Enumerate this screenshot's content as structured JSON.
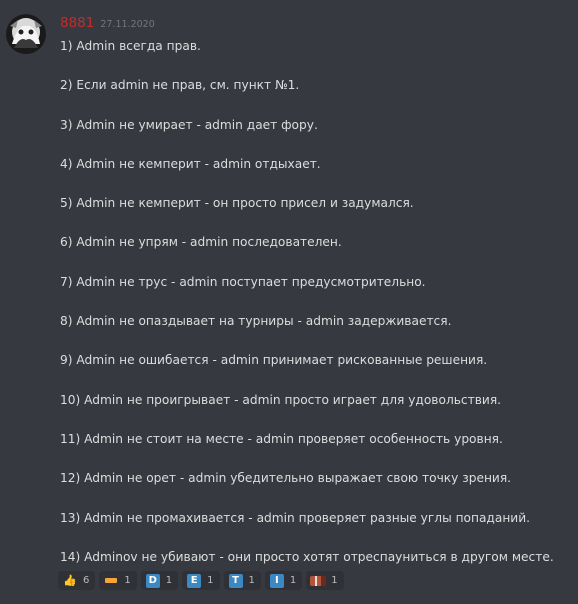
{
  "message": {
    "username": "8881",
    "timestamp": "27.11.2020",
    "lines": [
      "1) Admin всегда прав.",
      "2) Если admin не прав, см. пункт №1.",
      "3) Admin не умирает - admin дает фору.",
      "4) Admin не кемперит - admin отдыхает.",
      "5) Admin не кемперит - он просто присел и задумался.",
      "6) Admin не упрям - admin последователен.",
      "7) Admin не трус - admin поступает предусмотрительно.",
      "8) Admin не опаздывает на турниры - admin задерживается.",
      "9) Admin не ошибается - admin принимает рискованные решения.",
      "10) Admin не проигрывает - admin просто играет для удовольствия.",
      "11) Admin не стоит на месте - admin проверяет особенность уровня.",
      "12) Admin не орет - admin убедительно выражает свою точку зрения.",
      "13) Admin не промахивается - admin проверяет разные углы попаданий.",
      "14) Adminov не убивают - они просто хотят отреспауниться в другом месте."
    ]
  },
  "reactions": [
    {
      "emoji": "thumbs-up-icon",
      "count": "6"
    },
    {
      "emoji": "dash-icon",
      "count": "1"
    },
    {
      "emoji": "regional-d-icon",
      "letter": "D",
      "count": "1"
    },
    {
      "emoji": "regional-e-icon",
      "letter": "E",
      "count": "1"
    },
    {
      "emoji": "regional-t-icon",
      "letter": "T",
      "count": "1"
    },
    {
      "emoji": "regional-i-icon",
      "letter": "I",
      "count": "1"
    },
    {
      "emoji": "custom-emoji-icon",
      "count": "1"
    }
  ],
  "colors": {
    "background": "#36393f",
    "username": "#c42b2b",
    "text": "#dcddde",
    "timestamp": "#72767d",
    "reaction_bg": "#2f3136",
    "regional_indicator": "#3b88c3"
  }
}
